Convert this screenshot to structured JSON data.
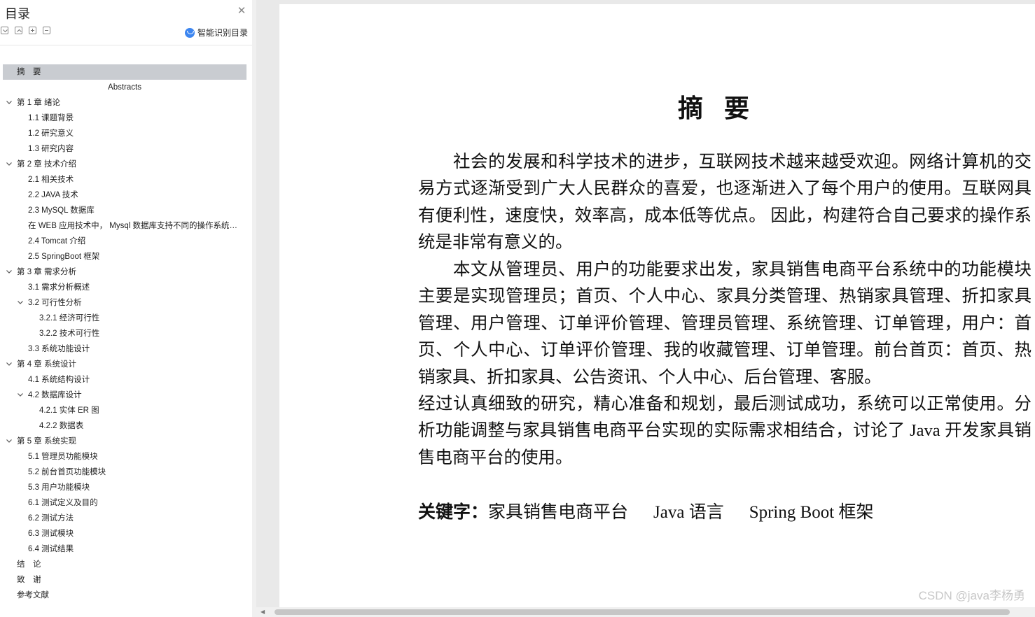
{
  "sidebar": {
    "title": "目录",
    "smart_toc_label": "智能识别目录",
    "items": [
      {
        "label": "摘　要",
        "level": 0,
        "expanded": null,
        "selected": true
      },
      {
        "label": "Abstracts",
        "level": -1,
        "expanded": null,
        "selected": false
      },
      {
        "label": "第 1 章  绪论",
        "level": 0,
        "expanded": true,
        "selected": false
      },
      {
        "label": "1.1 课题背景",
        "level": 1,
        "expanded": null,
        "selected": false
      },
      {
        "label": "1.2 研究意义",
        "level": 1,
        "expanded": null,
        "selected": false
      },
      {
        "label": "1.3 研究内容",
        "level": 1,
        "expanded": null,
        "selected": false
      },
      {
        "label": "第 2 章  技术介绍",
        "level": 0,
        "expanded": true,
        "selected": false
      },
      {
        "label": "2.1 相关技术",
        "level": 1,
        "expanded": null,
        "selected": false
      },
      {
        "label": "2.2 JAVA 技术",
        "level": 1,
        "expanded": null,
        "selected": false
      },
      {
        "label": "2.3 MySQL 数据库",
        "level": 1,
        "expanded": null,
        "selected": false
      },
      {
        "label": "在 WEB 应用技术中，  Mysql 数据库支持不同的操作系统平台，虽然在不同平台下的安装和设置的过程不同",
        "level": 1,
        "expanded": null,
        "selected": false
      },
      {
        "label": "2.4 Tomcat 介绍",
        "level": 1,
        "expanded": null,
        "selected": false
      },
      {
        "label": "2.5 SpringBoot 框架",
        "level": 1,
        "expanded": null,
        "selected": false
      },
      {
        "label": "第 3 章  需求分析",
        "level": 0,
        "expanded": true,
        "selected": false
      },
      {
        "label": "3.1 需求分析概述",
        "level": 1,
        "expanded": null,
        "selected": false
      },
      {
        "label": "3.2 可行性分析",
        "level": 1,
        "expanded": true,
        "selected": false
      },
      {
        "label": "3.2.1 经济可行性",
        "level": 2,
        "expanded": null,
        "selected": false
      },
      {
        "label": "3.2.2 技术可行性",
        "level": 2,
        "expanded": null,
        "selected": false
      },
      {
        "label": "3.3 系统功能设计",
        "level": 1,
        "expanded": null,
        "selected": false
      },
      {
        "label": "第 4 章  系统设计",
        "level": 0,
        "expanded": true,
        "selected": false
      },
      {
        "label": "4.1 系统结构设计",
        "level": 1,
        "expanded": null,
        "selected": false
      },
      {
        "label": "4.2 数据库设计",
        "level": 1,
        "expanded": true,
        "selected": false
      },
      {
        "label": "4.2.1 实体 ER 图",
        "level": 2,
        "expanded": null,
        "selected": false
      },
      {
        "label": "4.2.2 数据表",
        "level": 2,
        "expanded": null,
        "selected": false
      },
      {
        "label": "第 5 章  系统实现",
        "level": 0,
        "expanded": true,
        "selected": false
      },
      {
        "label": "5.1 管理员功能模块",
        "level": 1,
        "expanded": null,
        "selected": false
      },
      {
        "label": "5.2 前台首页功能模块",
        "level": 1,
        "expanded": null,
        "selected": false
      },
      {
        "label": "5.3 用户功能模块",
        "level": 1,
        "expanded": null,
        "selected": false
      },
      {
        "label": "6.1 测试定义及目的",
        "level": 1,
        "expanded": null,
        "selected": false
      },
      {
        "label": "6.2 测试方法",
        "level": 1,
        "expanded": null,
        "selected": false
      },
      {
        "label": "6.3 测试模块",
        "level": 1,
        "expanded": null,
        "selected": false
      },
      {
        "label": "6.4 测试结果",
        "level": 1,
        "expanded": null,
        "selected": false
      },
      {
        "label": "结　论",
        "level": 0,
        "expanded": null,
        "selected": false
      },
      {
        "label": "致　谢",
        "level": 0,
        "expanded": null,
        "selected": false
      },
      {
        "label": "参考文献",
        "level": 0,
        "expanded": null,
        "selected": false
      }
    ]
  },
  "document": {
    "title": "摘要",
    "paragraphs": [
      "社会的发展和科学技术的进步，互联网技术越来越受欢迎。网络计算机的交易方式逐渐受到广大人民群众的喜爱，也逐渐进入了每个用户的使用。互联网具有便利性，速度快，效率高，成本低等优点。 因此，构建符合自己要求的操作系统是非常有意义的。",
      "本文从管理员、用户的功能要求出发，家具销售电商平台系统中的功能模块主要是实现管理员；首页、个人中心、家具分类管理、热销家具管理、折扣家具管理、用户管理、订单评价管理、管理员管理、系统管理、订单管理，用户：首页、个人中心、订单评价管理、我的收藏管理、订单管理。前台首页：首页、热销家具、折扣家具、公告资讯、个人中心、后台管理、客服。",
      "经过认真细致的研究，精心准备和规划，最后测试成功，系统可以正常使用。分析功能调整与家具销售电商平台实现的实际需求相结合，讨论了 Java 开发家具销售电商平台的使用。"
    ],
    "keywords_label": "关键字：",
    "keywords": [
      "家具销售电商平台",
      "Java 语言",
      "Spring   Boot 框架"
    ]
  },
  "watermark": "CSDN @java李杨勇",
  "colors": {
    "selected_bg": "#c9ccd1",
    "smart_icon": "#3d86f0",
    "doc_bg": "#e9e9e9"
  }
}
